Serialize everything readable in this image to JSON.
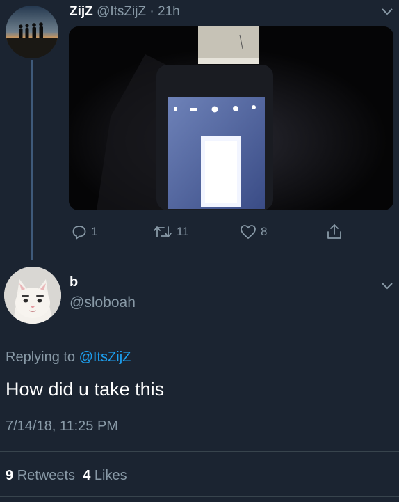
{
  "parent_tweet": {
    "name": "ZijZ",
    "handle": "@ItsZijZ",
    "separator": "·",
    "time": "21h",
    "actions": {
      "replies": "1",
      "retweets": "11",
      "likes": "8"
    }
  },
  "reply_tweet": {
    "name": "b",
    "handle": "@sloboah",
    "replying_prefix": "Replying to",
    "replying_to": "@ItsZijZ",
    "text": "How did u take this",
    "date": "7/14/18, 11:25 PM",
    "stats": {
      "retweets_count": "9",
      "retweets_label": "Retweets",
      "likes_count": "4",
      "likes_label": "Likes"
    }
  },
  "colors": {
    "background": "#1b2431",
    "secondary_text": "#8899a6",
    "link": "#1da1f2",
    "thread_line": "#3f5a7a"
  },
  "icons": [
    "reply-icon",
    "retweet-icon",
    "like-icon",
    "share-icon",
    "chevron-down-icon"
  ]
}
